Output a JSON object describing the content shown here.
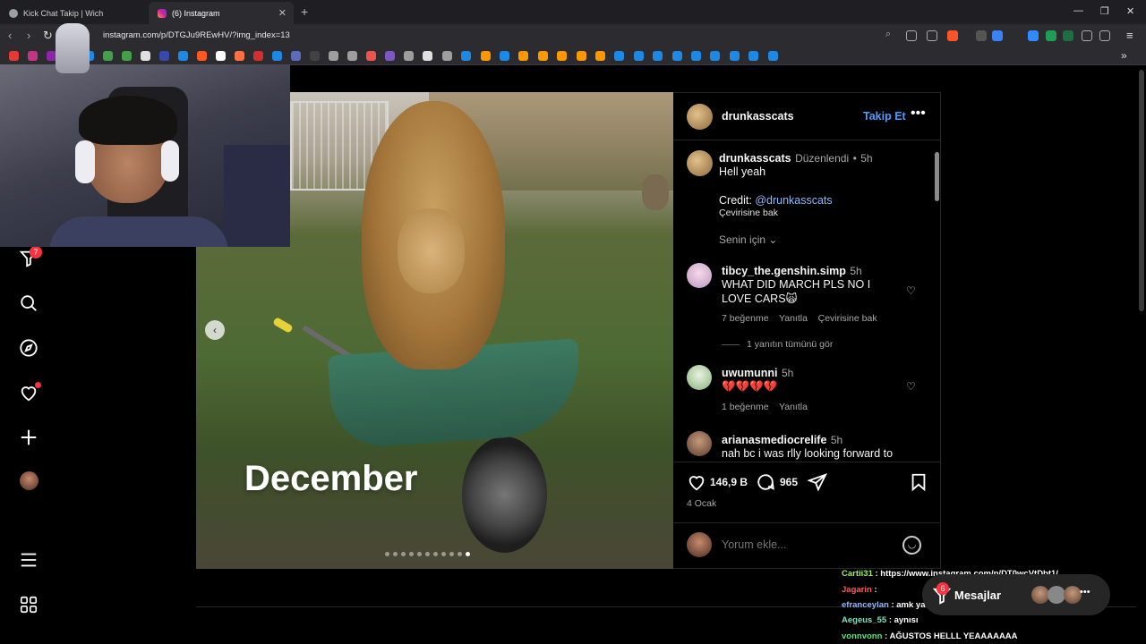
{
  "browser": {
    "tabs": [
      {
        "label": "Kick Chat Takip | Wich"
      },
      {
        "label": "(6) Instagram"
      }
    ],
    "url": "instagram.com/p/DTGJu9REwHV/?img_index=13"
  },
  "sidebar": {
    "notifications_count": "7"
  },
  "post": {
    "image_caption": "December",
    "carousel": {
      "count": 11,
      "active_index": 11
    },
    "author": "drunkasscats",
    "follow_label": "Takip Et",
    "caption": {
      "username": "drunkasscats",
      "edited": "Düzenlendi",
      "time": "5h",
      "line1": "Hell yeah",
      "credit_prefix": "Credit:",
      "credit_handle": "@drunkasscats",
      "see_translation": "Çevirisine bak"
    },
    "for_you_label": "Senin için",
    "comments": [
      {
        "username": "tibcy_the.genshin.simp",
        "time": "5h",
        "text": "WHAT DID MARCH PLS NO I LOVE CARS🙀",
        "likes": "7 beğenme",
        "reply": "Yanıtla",
        "translate": "Çevirisine bak",
        "view_replies": "1 yanıtın tümünü gör"
      },
      {
        "username": "uwumunni",
        "time": "5h",
        "text": "💔💔💔💔",
        "likes": "1 beğenme",
        "reply": "Yanıtla"
      },
      {
        "username": "arianasmediocrelife",
        "time": "5h",
        "text": "nah bc i was rlly looking forward to"
      }
    ],
    "like_count": "146,9 B",
    "comment_count": "965",
    "date": "4 Ocak",
    "comment_placeholder": "Yorum ekle..."
  },
  "messages": {
    "label": "Mesajlar",
    "count": "6"
  },
  "chat_overlay": [
    {
      "user": "Cartii31",
      "text": ": https://www.instagram.com/p/DT0wcVtDbt1/",
      "color": "#9cf06a"
    },
    {
      "user": "Jagarin",
      "text": ":",
      "color": "#ff5a5a"
    },
    {
      "user": "efranceylan",
      "text": ": amk ya",
      "color": "#8fb8ff"
    },
    {
      "user": "Aegeus_55",
      "text": ": aynısı",
      "color": "#7fe0c2"
    },
    {
      "user": "vonnvonn",
      "text": ": AĞUSTOS HELLL YEAAAAAAA",
      "color": "#5be37a"
    }
  ],
  "colors": {
    "accent_blue": "#4f9bff",
    "badge_red": "#ff3040",
    "background": "#000000"
  }
}
